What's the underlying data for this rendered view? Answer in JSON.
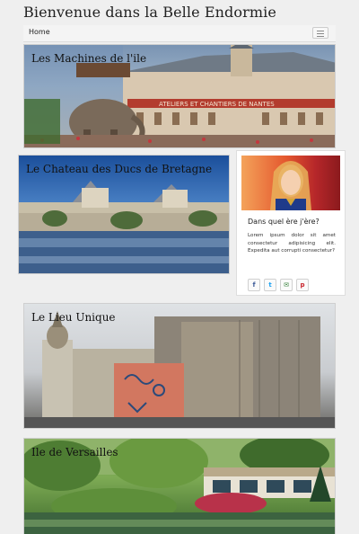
{
  "site": {
    "title": "Bienvenue dans la Belle Endormie"
  },
  "nav": {
    "home_label": "Home"
  },
  "cards": [
    {
      "title": "Les Machines de l'ile"
    },
    {
      "title": "Le Chateau des Ducs de Bretagne"
    },
    {
      "title": "Le Lieu Unique"
    },
    {
      "title": "Ile de Versailles"
    }
  ],
  "card1_sign": "ATELIERS ET CHANTIERS DE NANTES",
  "widget": {
    "heading": "Dans quel ère j'ère?",
    "text": "Lorem ipsum dolor sit amet consectetur adipisicing elit. Expedita aut corrupti consectetur?",
    "share": [
      {
        "icon": "facebook-icon",
        "glyph": "f",
        "color": "#3b5998"
      },
      {
        "icon": "twitter-icon",
        "glyph": "t",
        "color": "#1da1f2"
      },
      {
        "icon": "email-icon",
        "glyph": "✉",
        "color": "#2e7d32"
      },
      {
        "icon": "pinterest-icon",
        "glyph": "p",
        "color": "#c8232c"
      }
    ]
  }
}
